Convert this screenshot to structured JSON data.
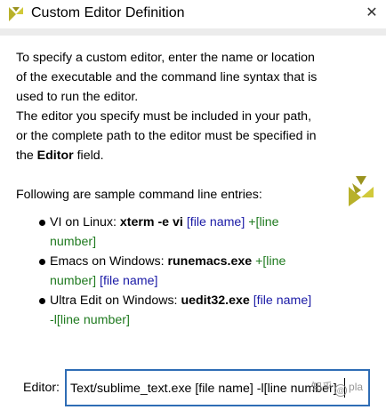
{
  "window": {
    "title": "Custom Editor Definition",
    "close_glyph": "✕",
    "accent_color": "#2f6db5",
    "logo_color": "#b8b12a"
  },
  "description": {
    "line1": "To specify a custom editor, enter the name or location",
    "line2": "of the executable and the command line syntax that is",
    "line3": "used to run the editor.",
    "line4": "The editor you specify must be included in your path,",
    "line5": "or the complete path to the editor must be specified in",
    "line6_prefix": "the ",
    "line6_bold": "Editor",
    "line6_suffix": " field."
  },
  "samples": {
    "heading": "Following are sample command line entries:",
    "items": [
      {
        "prefix": "VI on Linux: ",
        "command": "xterm -e vi",
        "arg1": "[file name]",
        "arg2_line1": "+[line",
        "arg2_line2": "number]"
      },
      {
        "prefix": "Emacs on Windows: ",
        "command": "runemacs.exe",
        "arg1_line1": "+[line",
        "arg1_line2": "number]",
        "arg2": "[file name]"
      },
      {
        "prefix": "Ultra Edit on Windows: ",
        "command": "uedit32.exe",
        "arg1": "[file name]",
        "arg2": "-l[line number]"
      }
    ]
  },
  "editor": {
    "label": "Editor:",
    "value": "Text/sublime_text.exe [file name] -l[line number]"
  },
  "watermark": {
    "text_left": "知乎",
    "text_right": "pla"
  }
}
